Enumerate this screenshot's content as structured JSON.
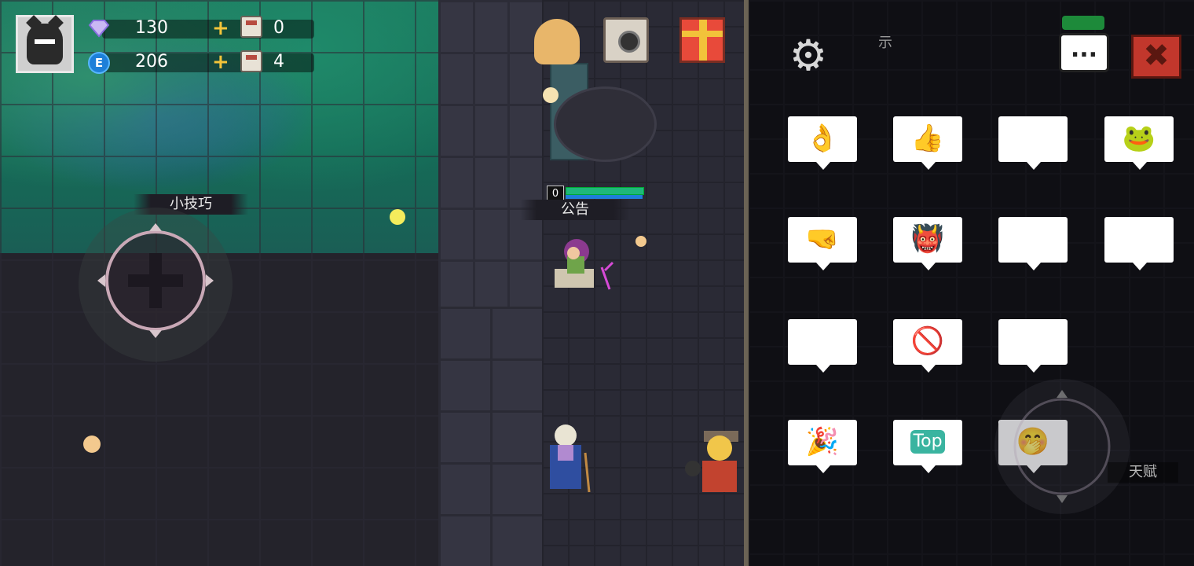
{
  "hud": {
    "gems": "130",
    "energy": "206",
    "energy_icon": "E",
    "material_a": "0",
    "material_b": "4",
    "plus": "+"
  },
  "labels": {
    "tips": "小技巧",
    "notice": "公告",
    "talent": "天赋",
    "partial_hint": "示"
  },
  "player": {
    "hp_number": "0"
  },
  "panel": {
    "chat_label": "...",
    "close_label": "✖",
    "settings_icon": "⚙"
  },
  "emotes": [
    {
      "name": "ok-hand",
      "glyph": "👌"
    },
    {
      "name": "thumbs-up",
      "glyph": "👍"
    },
    {
      "name": "shocked-face",
      "glyph": "😱"
    },
    {
      "name": "green-blob-happy",
      "glyph": "🐸"
    },
    {
      "name": "fist-knife",
      "glyph": "🤜"
    },
    {
      "name": "red-demon",
      "glyph": "👹"
    },
    {
      "name": "laughing-face",
      "glyph": "😂"
    },
    {
      "name": "green-blob-grin",
      "glyph": "😁"
    },
    {
      "name": "sword",
      "glyph": "🗡"
    },
    {
      "name": "no-sword",
      "glyph": "🚫"
    },
    {
      "name": "love-face",
      "glyph": "😍"
    },
    {
      "name": "confetti",
      "glyph": "🎉"
    },
    {
      "name": "top",
      "text": "Top"
    },
    {
      "name": "pink-hair-girl",
      "glyph": "🤭"
    }
  ]
}
